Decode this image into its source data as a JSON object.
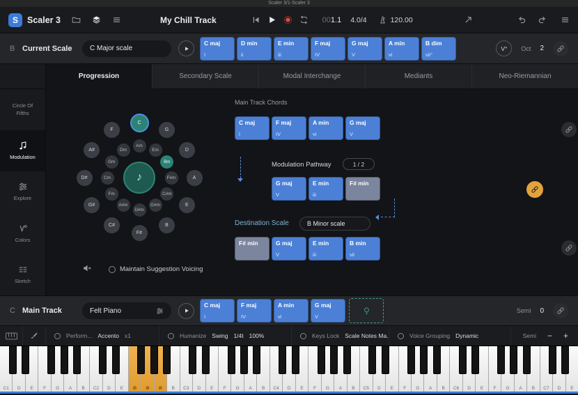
{
  "window": {
    "title": "Scaler 3/1-Scaler 3"
  },
  "header": {
    "logo_letter": "S",
    "app_name": "Scaler 3",
    "track_title": "My Chill Track",
    "position_prefix": "00",
    "position": "1.1",
    "time_signature": "4.0/4",
    "tempo": "120.00"
  },
  "scale_row": {
    "row_letter": "B",
    "label": "Current Scale",
    "scale_name": "C Major scale",
    "chords": [
      {
        "name": "C maj",
        "numeral": "I"
      },
      {
        "name": "D min",
        "numeral": "ii"
      },
      {
        "name": "E min",
        "numeral": "iii"
      },
      {
        "name": "F maj",
        "numeral": "IV"
      },
      {
        "name": "G maj",
        "numeral": "V"
      },
      {
        "name": "A min",
        "numeral": "vi"
      },
      {
        "name": "B dim",
        "numeral": "vii°"
      }
    ],
    "voicing_button": "V°",
    "oct_label": "Oct",
    "oct_value": "2"
  },
  "tabs": [
    {
      "label": "Progression",
      "active": true
    },
    {
      "label": "Secondary Scale"
    },
    {
      "label": "Modal Interchange"
    },
    {
      "label": "Mediants"
    },
    {
      "label": "Neo-Riemannian"
    }
  ],
  "sidebar": [
    {
      "label": "Circle Of Fifths"
    },
    {
      "label": "Modulation",
      "icon": "music-note",
      "active": true
    },
    {
      "label": "Explore",
      "icon": "sliders"
    },
    {
      "label": "Colors",
      "icon": "voicing"
    },
    {
      "label": "Sketch",
      "icon": "grid"
    }
  ],
  "circle_of_fifths": {
    "outer": [
      {
        "label": "C",
        "selected": true
      },
      {
        "label": "G"
      },
      {
        "label": "D"
      },
      {
        "label": "A"
      },
      {
        "label": "E"
      },
      {
        "label": "B"
      },
      {
        "label": "F#"
      },
      {
        "label": "C#"
      },
      {
        "label": "G#"
      },
      {
        "label": "D#"
      },
      {
        "label": "A#"
      },
      {
        "label": "F"
      }
    ],
    "inner": [
      {
        "label": "Am"
      },
      {
        "label": "Em"
      },
      {
        "label": "Bm",
        "selected": true
      },
      {
        "label": "F#m"
      },
      {
        "label": "C#m"
      },
      {
        "label": "G#m"
      },
      {
        "label": "D#m"
      },
      {
        "label": "A#m"
      },
      {
        "label": "Fm"
      },
      {
        "label": "Cm"
      },
      {
        "label": "Gm"
      },
      {
        "label": "Dm"
      }
    ],
    "center_glyph": "♪"
  },
  "modulation_panel": {
    "main_track_chords_label": "Main Track Chords",
    "main_track_chords": [
      {
        "name": "C maj",
        "numeral": "I"
      },
      {
        "name": "F maj",
        "numeral": "IV"
      },
      {
        "name": "A min",
        "numeral": "vi"
      },
      {
        "name": "G maj",
        "numeral": "V"
      }
    ],
    "pathway_label": "Modulation Pathway",
    "pathway_page": "1 / 2",
    "pathway_chords": [
      {
        "name": "G maj",
        "numeral": "V"
      },
      {
        "name": "E min",
        "numeral": "iii"
      },
      {
        "name": "F# min",
        "numeral": "",
        "style": "muted"
      }
    ],
    "destination_label": "Destination Scale",
    "destination_scale": "B Minor scale",
    "destination_chords": [
      {
        "name": "F# min",
        "numeral": "",
        "style": "muted"
      },
      {
        "name": "G maj",
        "numeral": "V"
      },
      {
        "name": "E min",
        "numeral": "iii"
      },
      {
        "name": "B min",
        "numeral": "vii"
      }
    ],
    "voicing_toggle_label": "Maintain Suggestion Voicing"
  },
  "track_row": {
    "row_letter": "C",
    "label": "Main Track",
    "instrument": "Felt Piano",
    "chords": [
      {
        "name": "C maj",
        "numeral": "I"
      },
      {
        "name": "F maj",
        "numeral": "IV"
      },
      {
        "name": "A min",
        "numeral": "vi"
      },
      {
        "name": "G maj",
        "numeral": "V"
      }
    ],
    "semi_label": "Semi",
    "semi_value": "0"
  },
  "toolbar": {
    "groups": [
      {
        "label": "Perform...",
        "values": [
          {
            "text": "Accento"
          },
          {
            "text": "x1",
            "dim": true
          }
        ]
      },
      {
        "label": "Humanize",
        "values": [
          {
            "text": "Swing"
          },
          {
            "text": "1/4t"
          },
          {
            "text": "100%"
          }
        ]
      },
      {
        "label": "Keys Lock",
        "values": [
          {
            "text": "Scale Notes Ma..."
          }
        ]
      },
      {
        "label": "Voice Grouping",
        "values": [
          {
            "text": "Dynamic"
          }
        ]
      }
    ],
    "semi_label": "Semi",
    "minus": "−",
    "plus": "+"
  },
  "piano": {
    "white_keys": 45,
    "first_octave": 1,
    "note_letters": "CDEFGAB",
    "orange_keys": [
      10,
      11,
      12
    ],
    "orange_key_label": "⊘"
  },
  "colors": {
    "chord_blue": "#4b80d6",
    "muted_chord": "#7b859e",
    "accent_orange": "#e2a33c",
    "accent_teal": "#2c8375",
    "selection_blue": "#4a90e2",
    "record_red": "#e04b3f",
    "piano_strip_blue": "#3d7bd8"
  }
}
